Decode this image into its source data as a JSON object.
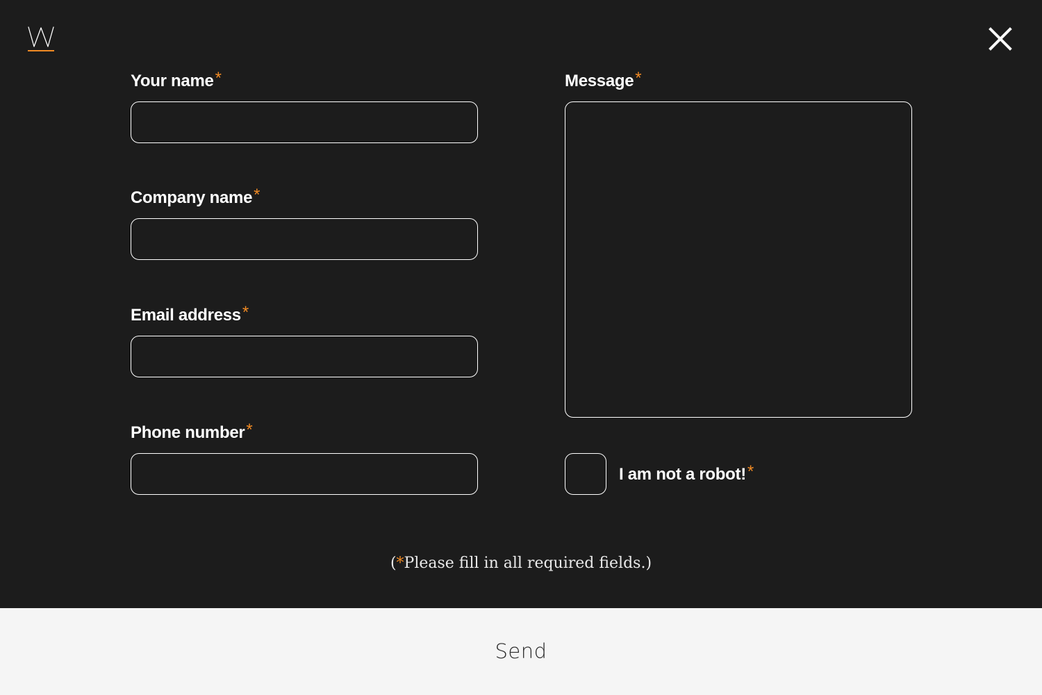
{
  "header": {
    "logo_text": "W",
    "close_icon": "close-icon"
  },
  "form": {
    "required_marker": "*",
    "fields": {
      "name": {
        "label": "Your name",
        "value": "",
        "placeholder": ""
      },
      "company": {
        "label": "Company name",
        "value": "",
        "placeholder": ""
      },
      "email": {
        "label": "Email address",
        "value": "",
        "placeholder": ""
      },
      "phone": {
        "label": "Phone number",
        "value": "",
        "placeholder": ""
      },
      "message": {
        "label": "Message",
        "value": "",
        "placeholder": ""
      }
    },
    "robot_check": {
      "label": "I am not a robot!",
      "checked": false
    },
    "note": {
      "open": "(",
      "star": "*",
      "text": "Please fill in all required fields.)"
    },
    "send_label": "Send"
  },
  "colors": {
    "background": "#1c1c1c",
    "accent": "#f08a24",
    "send_bar": "#f5f5f5",
    "text": "#ffffff"
  }
}
